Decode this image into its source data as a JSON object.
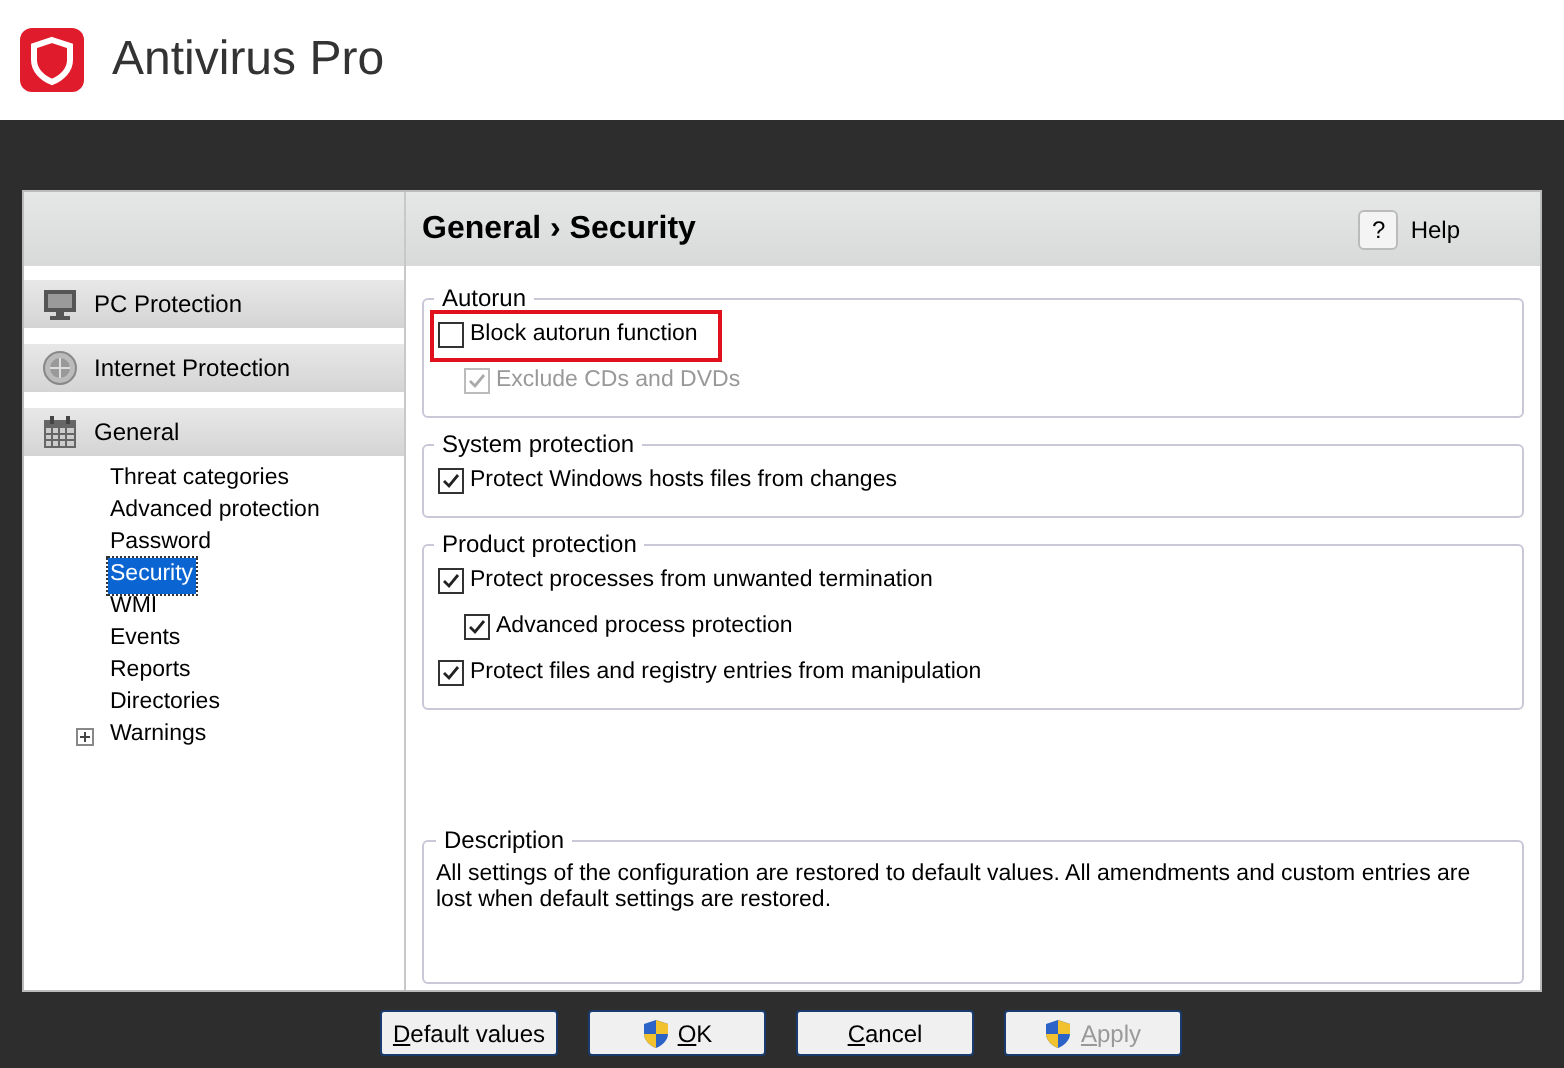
{
  "app": {
    "title": "Antivirus Pro"
  },
  "sidebar": {
    "sections": [
      {
        "label": "PC Protection"
      },
      {
        "label": "Internet Protection"
      },
      {
        "label": "General",
        "children": [
          {
            "label": "Threat categories",
            "selected": false,
            "expandable": false
          },
          {
            "label": "Advanced protection",
            "selected": false,
            "expandable": false
          },
          {
            "label": "Password",
            "selected": false,
            "expandable": false
          },
          {
            "label": "Security",
            "selected": true,
            "expandable": false
          },
          {
            "label": "WMI",
            "selected": false,
            "expandable": false
          },
          {
            "label": "Events",
            "selected": false,
            "expandable": false
          },
          {
            "label": "Reports",
            "selected": false,
            "expandable": false
          },
          {
            "label": "Directories",
            "selected": false,
            "expandable": false
          },
          {
            "label": "Warnings",
            "selected": false,
            "expandable": true
          }
        ]
      }
    ]
  },
  "content": {
    "breadcrumb": "General › Security",
    "help": {
      "icon": "?",
      "label": "Help"
    },
    "groups": [
      {
        "title": "Autorun",
        "options": [
          {
            "label": "Block autorun function",
            "checked": false,
            "disabled": false,
            "highlighted": true,
            "children": [
              {
                "label": "Exclude CDs and DVDs",
                "checked": true,
                "disabled": true,
                "highlighted": false
              }
            ]
          }
        ]
      },
      {
        "title": "System protection",
        "options": [
          {
            "label": "Protect Windows hosts files from changes",
            "checked": true,
            "disabled": false,
            "highlighted": false
          }
        ]
      },
      {
        "title": "Product protection",
        "options": [
          {
            "label": "Protect processes from unwanted termination",
            "checked": true,
            "disabled": false,
            "highlighted": false,
            "children": [
              {
                "label": "Advanced process protection",
                "checked": true,
                "disabled": false,
                "highlighted": false
              }
            ]
          },
          {
            "label": "Protect files and registry entries from manipulation",
            "checked": true,
            "disabled": false,
            "highlighted": false
          }
        ]
      }
    ],
    "description": {
      "title": "Description",
      "text": "All settings of the configuration are restored to default values. All amendments and custom entries are lost when default settings are restored."
    }
  },
  "buttons": [
    {
      "label": "Default values",
      "shield": false,
      "disabled": false
    },
    {
      "label": "OK",
      "shield": true,
      "disabled": false
    },
    {
      "label": "Cancel",
      "shield": false,
      "disabled": false
    },
    {
      "label": "Apply",
      "shield": true,
      "disabled": true
    }
  ]
}
